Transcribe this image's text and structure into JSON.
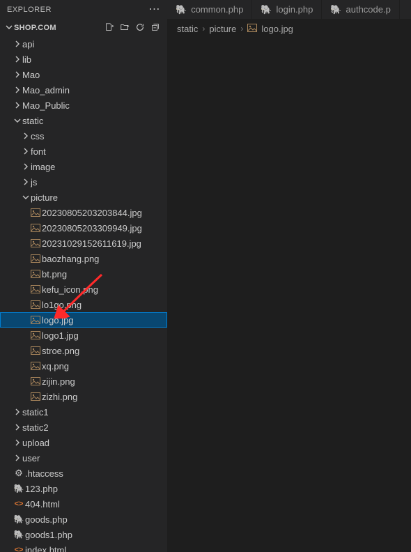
{
  "explorer": {
    "title": "EXPLORER",
    "workspace_title": "SHOP.COM"
  },
  "tree": [
    {
      "depth": 0,
      "type": "folder",
      "expanded": false,
      "name": "api"
    },
    {
      "depth": 0,
      "type": "folder",
      "expanded": false,
      "name": "lib"
    },
    {
      "depth": 0,
      "type": "folder",
      "expanded": false,
      "name": "Mao"
    },
    {
      "depth": 0,
      "type": "folder",
      "expanded": false,
      "name": "Mao_admin"
    },
    {
      "depth": 0,
      "type": "folder",
      "expanded": false,
      "name": "Mao_Public"
    },
    {
      "depth": 0,
      "type": "folder",
      "expanded": true,
      "name": "static"
    },
    {
      "depth": 1,
      "type": "folder",
      "expanded": false,
      "name": "css"
    },
    {
      "depth": 1,
      "type": "folder",
      "expanded": false,
      "name": "font"
    },
    {
      "depth": 1,
      "type": "folder",
      "expanded": false,
      "name": "image"
    },
    {
      "depth": 1,
      "type": "folder",
      "expanded": false,
      "name": "js"
    },
    {
      "depth": 1,
      "type": "folder",
      "expanded": true,
      "name": "picture"
    },
    {
      "depth": 2,
      "type": "file",
      "kind": "img",
      "name": "20230805203203844.jpg"
    },
    {
      "depth": 2,
      "type": "file",
      "kind": "img",
      "name": "20230805203309949.jpg"
    },
    {
      "depth": 2,
      "type": "file",
      "kind": "img",
      "name": "20231029152611619.jpg"
    },
    {
      "depth": 2,
      "type": "file",
      "kind": "img",
      "name": "baozhang.png"
    },
    {
      "depth": 2,
      "type": "file",
      "kind": "img",
      "name": "bt.png"
    },
    {
      "depth": 2,
      "type": "file",
      "kind": "img",
      "name": "kefu_icon.png"
    },
    {
      "depth": 2,
      "type": "file",
      "kind": "img",
      "name": "lo1go.png"
    },
    {
      "depth": 2,
      "type": "file",
      "kind": "img",
      "name": "logo.jpg",
      "selected": true
    },
    {
      "depth": 2,
      "type": "file",
      "kind": "img",
      "name": "logo1.jpg"
    },
    {
      "depth": 2,
      "type": "file",
      "kind": "img",
      "name": "stroe.png"
    },
    {
      "depth": 2,
      "type": "file",
      "kind": "img",
      "name": "xq.png"
    },
    {
      "depth": 2,
      "type": "file",
      "kind": "img",
      "name": "zijin.png"
    },
    {
      "depth": 2,
      "type": "file",
      "kind": "img",
      "name": "zizhi.png"
    },
    {
      "depth": 0,
      "type": "folder",
      "expanded": false,
      "name": "static1"
    },
    {
      "depth": 0,
      "type": "folder",
      "expanded": false,
      "name": "static2"
    },
    {
      "depth": 0,
      "type": "folder",
      "expanded": false,
      "name": "upload"
    },
    {
      "depth": 0,
      "type": "folder",
      "expanded": false,
      "name": "user"
    },
    {
      "depth": 0,
      "type": "file",
      "kind": "gear",
      "name": ".htaccess"
    },
    {
      "depth": 0,
      "type": "file",
      "kind": "php",
      "name": "123.php"
    },
    {
      "depth": 0,
      "type": "file",
      "kind": "html",
      "name": "404.html"
    },
    {
      "depth": 0,
      "type": "file",
      "kind": "php",
      "name": "goods.php"
    },
    {
      "depth": 0,
      "type": "file",
      "kind": "php",
      "name": "goods1.php"
    },
    {
      "depth": 0,
      "type": "file",
      "kind": "html",
      "name": "index.html"
    }
  ],
  "tabs": [
    {
      "name": "common.php",
      "kind": "php"
    },
    {
      "name": "login.php",
      "kind": "php"
    },
    {
      "name": "authcode.p",
      "kind": "php"
    }
  ],
  "breadcrumb": [
    {
      "name": "static",
      "kind": "text"
    },
    {
      "name": "picture",
      "kind": "text"
    },
    {
      "name": "logo.jpg",
      "kind": "img"
    }
  ]
}
